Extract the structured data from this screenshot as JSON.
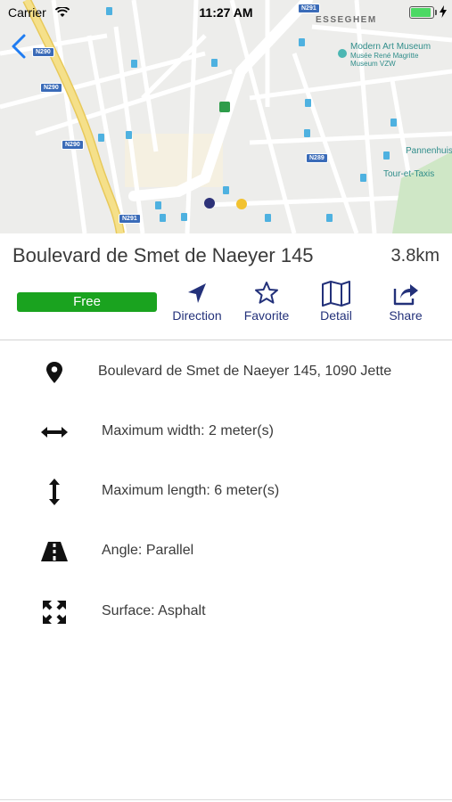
{
  "status_bar": {
    "carrier": "Carrier",
    "time": "11:27 AM",
    "battery_level": 1.0
  },
  "map": {
    "district_label": "ESSEGHEM",
    "poi_name": "Modern Art Museum",
    "poi_subtitle": "Musée René Magritte",
    "poi_subtitle2": "Museum VZW",
    "place_right": "Pannenhuis",
    "place_right2": "Tour-et-Taxis",
    "road_labels": [
      "N291",
      "N290",
      "N290",
      "N290",
      "N289",
      "N291"
    ],
    "colors": {
      "selected_marker": "#2d3278",
      "other_marker": "#f2c230",
      "highway": "#f5e08a",
      "water_route": "#8ad1f0"
    }
  },
  "header": {
    "title": "Boulevard de Smet de Naeyer 145",
    "distance": "3.8km",
    "status_badge": "Free",
    "status_color": "#1aa31f"
  },
  "actions": [
    {
      "label": "Direction",
      "icon": "navigation-arrow-icon"
    },
    {
      "label": "Favorite",
      "icon": "star-icon"
    },
    {
      "label": "Detail",
      "icon": "map-icon"
    },
    {
      "label": "Share",
      "icon": "share-icon"
    }
  ],
  "details": [
    {
      "icon": "location-pin-icon",
      "text": "Boulevard de Smet de Naeyer 145, 1090 Jette"
    },
    {
      "icon": "horizontal-arrows-icon",
      "text": "Maximum width: 2 meter(s)"
    },
    {
      "icon": "vertical-arrows-icon",
      "text": "Maximum length: 6 meter(s)"
    },
    {
      "icon": "road-icon",
      "text": "Angle: Parallel"
    },
    {
      "icon": "expand-arrows-icon",
      "text": "Surface: Asphalt"
    }
  ],
  "accent_color": "#23317a"
}
